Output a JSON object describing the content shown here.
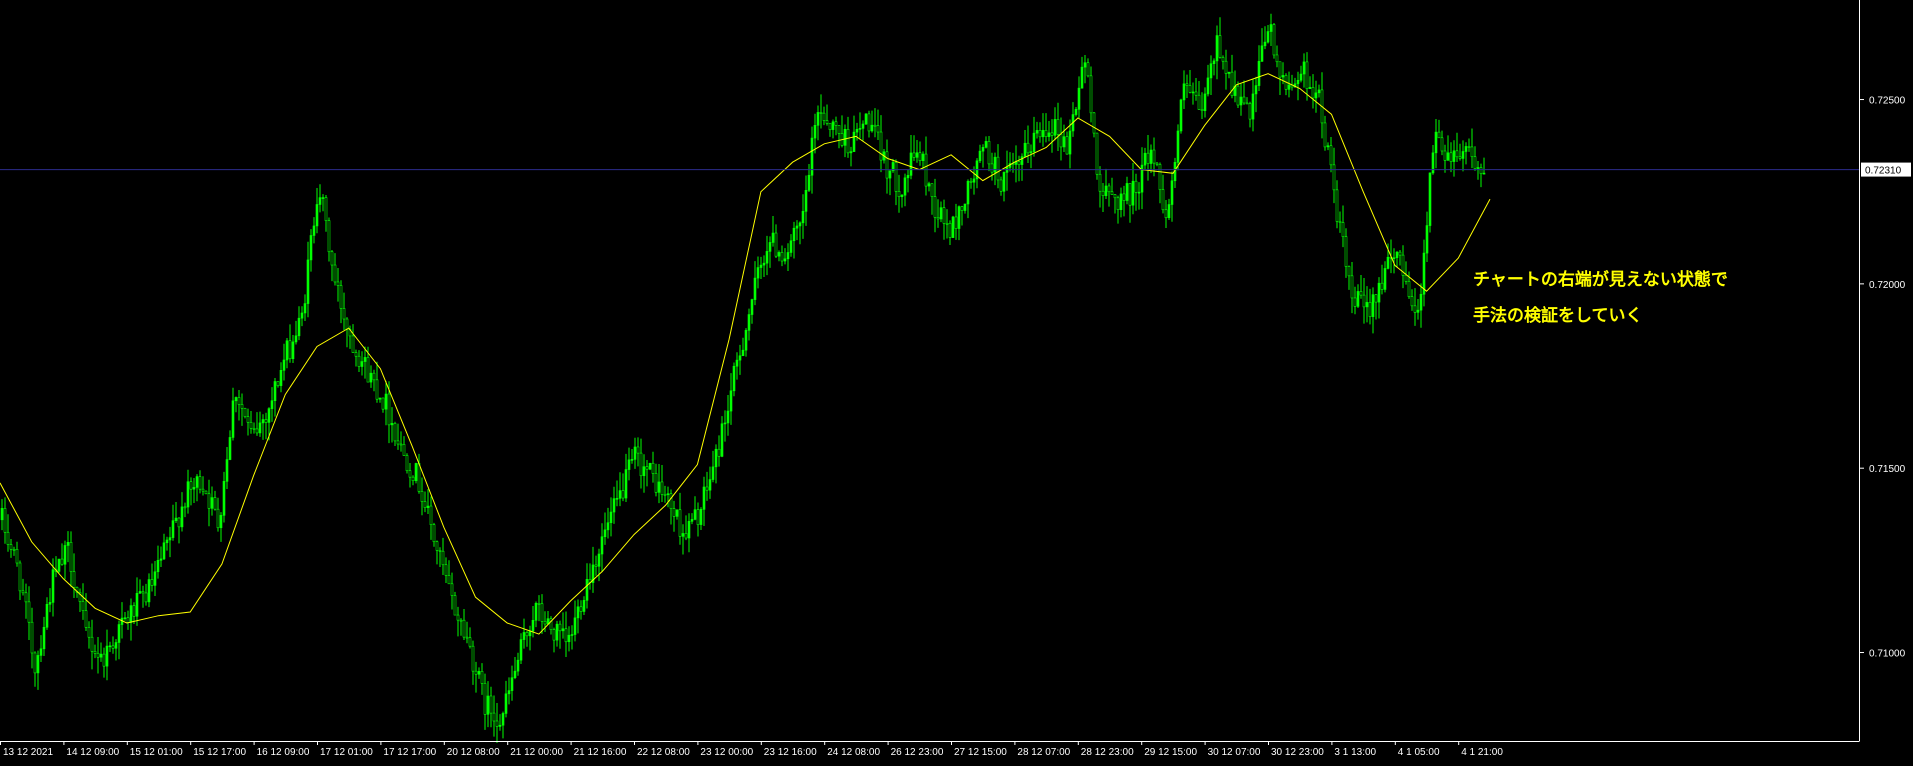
{
  "chart_data": {
    "type": "candlestick",
    "overlay": "moving average",
    "colors": {
      "background": "#000000",
      "candle": "#00ff00",
      "moving_average": "#ffff00",
      "price_line": "#2b2b8c",
      "axis": "#ffffff",
      "annotation": "#ffff00"
    },
    "y_axis": {
      "ticks": [
        "0.72500",
        "0.72000",
        "0.71500",
        "0.71000"
      ],
      "tick_values": [
        0.725,
        0.72,
        0.715,
        0.71
      ],
      "ylim": [
        0.7076,
        0.7277
      ]
    },
    "current_price": {
      "value": 0.7231,
      "label": "0.72310"
    },
    "x_axis": {
      "tick_labels": [
        "13 12 2021",
        "14 12 09:00",
        "15 12 01:00",
        "15 12 17:00",
        "16 12 09:00",
        "17 12 01:00",
        "17 12 17:00",
        "20 12 08:00",
        "21 12 00:00",
        "21 12 16:00",
        "22 12 08:00",
        "23 12 00:00",
        "23 12 16:00",
        "24 12 08:00",
        "26 12 23:00",
        "27 12 15:00",
        "28 12 07:00",
        "28 12 23:00",
        "29 12 15:00",
        "30 12 07:00",
        "30 12 23:00",
        "3 1 13:00",
        "4 1 05:00",
        "4 1 21:00"
      ]
    },
    "price_path": [
      0.7136,
      0.7122,
      0.7096,
      0.7119,
      0.7128,
      0.7105,
      0.7098,
      0.7106,
      0.7112,
      0.7118,
      0.713,
      0.7142,
      0.7147,
      0.7135,
      0.7172,
      0.7158,
      0.7166,
      0.718,
      0.719,
      0.7228,
      0.72,
      0.7185,
      0.7176,
      0.7168,
      0.7155,
      0.7147,
      0.713,
      0.7114,
      0.7103,
      0.7086,
      0.7082,
      0.7098,
      0.7112,
      0.7106,
      0.7102,
      0.7118,
      0.713,
      0.7141,
      0.7153,
      0.7148,
      0.7141,
      0.7132,
      0.7139,
      0.7155,
      0.7175,
      0.7195,
      0.7212,
      0.7208,
      0.7215,
      0.7248,
      0.7242,
      0.7238,
      0.7245,
      0.7233,
      0.7226,
      0.7237,
      0.7221,
      0.7214,
      0.7225,
      0.7237,
      0.7228,
      0.7231,
      0.724,
      0.7244,
      0.7237,
      0.7262,
      0.7224,
      0.7223,
      0.7225,
      0.7237,
      0.7218,
      0.7254,
      0.7246,
      0.7266,
      0.7252,
      0.7245,
      0.7271,
      0.7252,
      0.7258,
      0.7252,
      0.7225,
      0.7196,
      0.7193,
      0.7203,
      0.7208,
      0.7189,
      0.724,
      0.7235,
      0.7238,
      0.7228
    ],
    "moving_average": [
      0.7146,
      0.713,
      0.712,
      0.7112,
      0.7108,
      0.711,
      0.7111,
      0.7124,
      0.7148,
      0.717,
      0.7183,
      0.7188,
      0.7177,
      0.7156,
      0.7134,
      0.7115,
      0.7108,
      0.7105,
      0.7114,
      0.7122,
      0.7132,
      0.714,
      0.7151,
      0.7185,
      0.7225,
      0.7233,
      0.7238,
      0.724,
      0.7234,
      0.7231,
      0.7235,
      0.7228,
      0.7233,
      0.7237,
      0.7245,
      0.724,
      0.7231,
      0.723,
      0.7243,
      0.7254,
      0.7257,
      0.7253,
      0.7246,
      0.7225,
      0.7205,
      0.7198,
      0.7207,
      0.7223
    ],
    "annotations": [
      "チャートの右端が見えない状態で",
      "手法の検証をしていく"
    ]
  }
}
